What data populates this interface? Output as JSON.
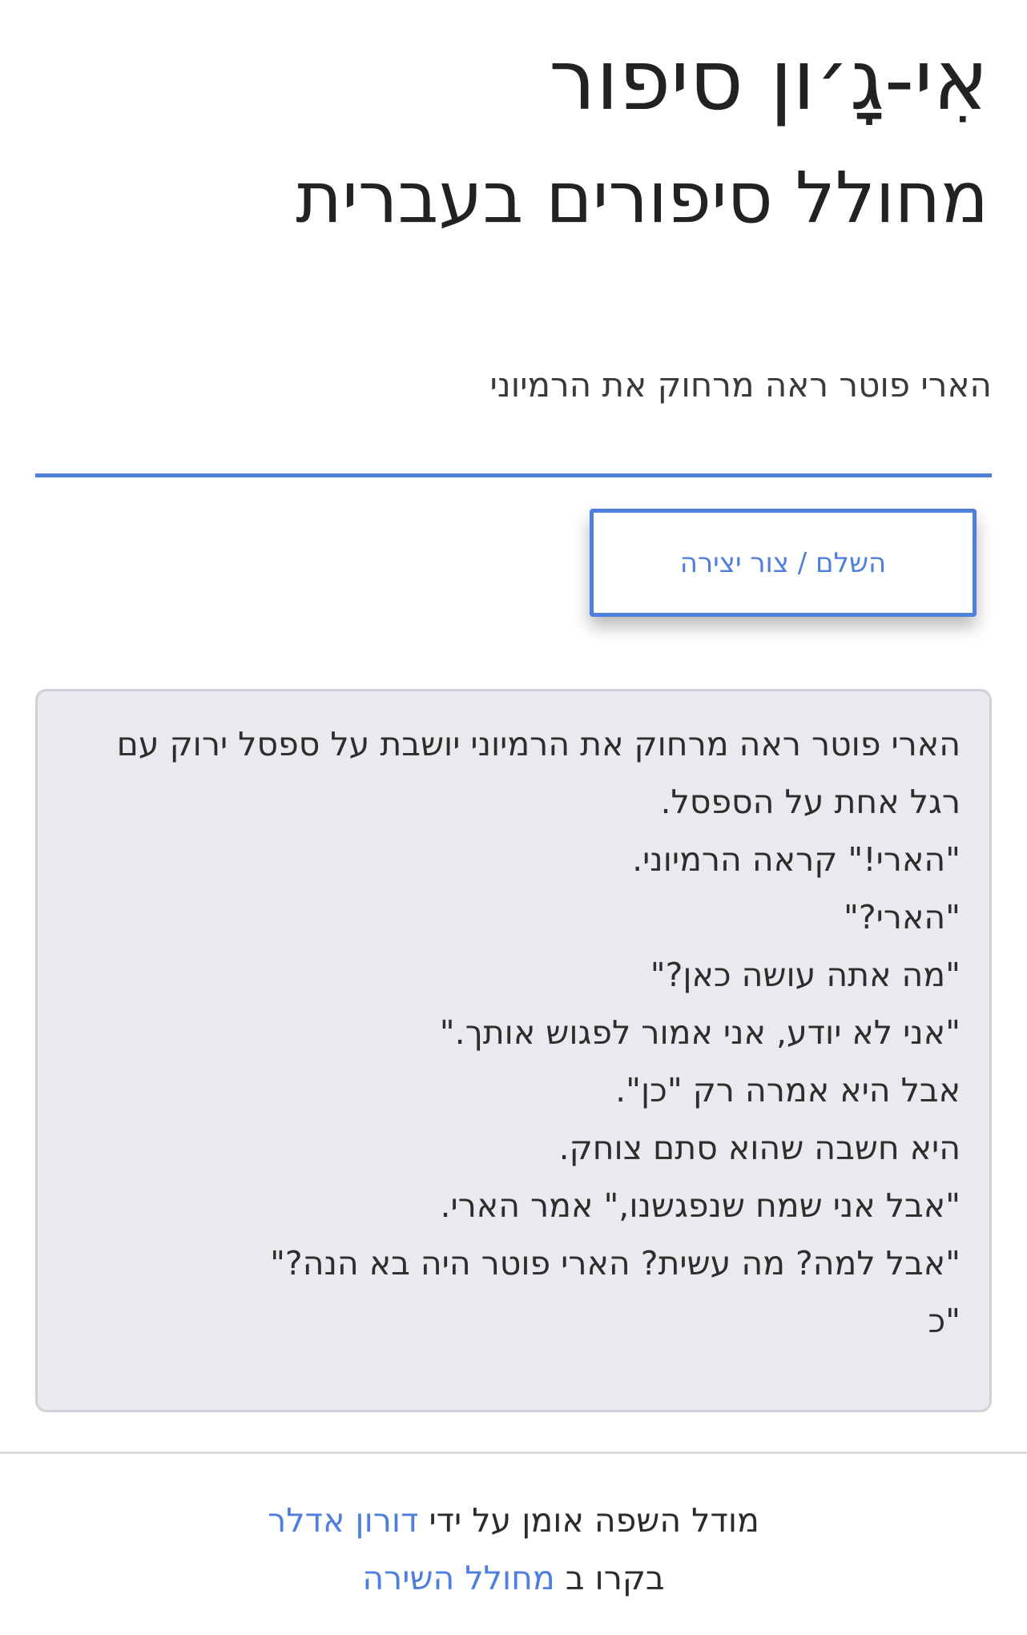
{
  "header": {
    "title": "אִי-גָ׳ון סיפור",
    "subtitle": "מחולל סיפורים בעברית"
  },
  "prompt": {
    "value": "הארי פוטר ראה מרחוק את הרמיוני"
  },
  "generate_button": {
    "label": "השלם / צור יצירה"
  },
  "story": {
    "lines": [
      "הארי פוטר ראה מרחוק את הרמיוני יושבת על ספסל ירוק עם",
      "רגל אחת על הספסל.",
      "\"הארי!\" קראה הרמיוני.",
      "\"הארי?\"",
      "\"מה אתה עושה כאן?\"",
      "\"אני לא יודע, אני אמור לפגוש אותך.\"",
      "אבל היא אמרה רק \"כן\".",
      "היא חשבה שהוא סתם צוחק.",
      "\"אבל אני שמח שנפגשנו,\" אמר הארי.",
      "\"אבל למה? מה עשית? הארי פוטר היה בא הנה?\"",
      "\"כ"
    ]
  },
  "footer": {
    "line1_text": "מודל השפה אומן על ידי",
    "line1_link": "דורון אדלר",
    "line2_text": "בקרו ב",
    "line2_link": "מחולל השירה"
  },
  "colors": {
    "accent": "#4e7fdd",
    "story_background": "#e9eaee",
    "text": "#2b2b2b"
  }
}
